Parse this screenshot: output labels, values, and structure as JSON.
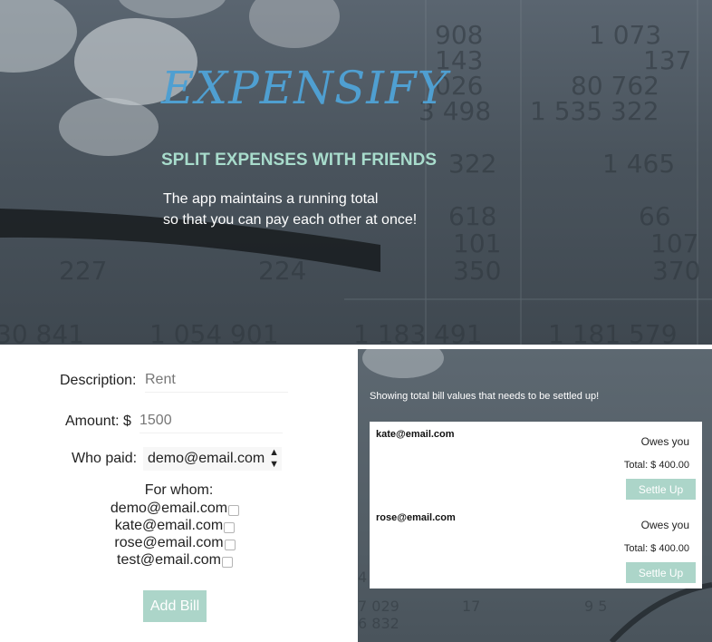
{
  "hero": {
    "title": "EXPENSIFY",
    "subtitle": "SPLIT EXPENSES WITH FRIENDS",
    "description_lines": [
      "The app maintains a running total",
      "so that you can pay each other at once!"
    ]
  },
  "form": {
    "description_label": "Description:",
    "description_value": "Rent",
    "amount_label": "Amount: $",
    "amount_value": "1500",
    "who_paid_label": "Who paid:",
    "who_paid_selected": "demo@email.com",
    "for_whom_label": "For whom:",
    "for_whom_options": [
      "demo@email.com",
      "kate@email.com",
      "rose@email.com",
      "test@email.com"
    ],
    "add_bill_label": "Add Bill"
  },
  "settle": {
    "heading": "Showing total bill values that needs to be settled up!",
    "entries": [
      {
        "email": "kate@email.com",
        "status": "Owes you",
        "total": "Total: $ 400.00",
        "button": "Settle Up"
      },
      {
        "email": "rose@email.com",
        "status": "Owes you",
        "total": "Total: $ 400.00",
        "button": "Settle Up"
      }
    ]
  },
  "colors": {
    "title_blue": "#4f9fd1",
    "subtitle_mint": "#a8dccc",
    "button_mint": "#acd5c9"
  }
}
